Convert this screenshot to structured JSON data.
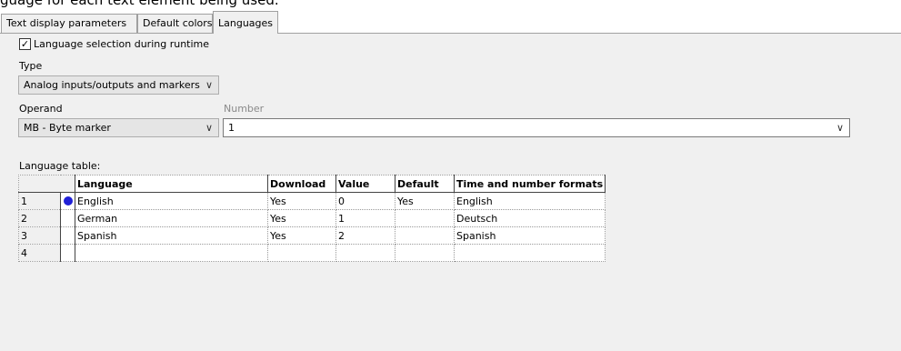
{
  "top_text": "guage for each text element being used.",
  "tabs": [
    {
      "label": "Text display parameters"
    },
    {
      "label": "Default colors"
    },
    {
      "label": "Languages",
      "active": true
    }
  ],
  "runtime_checkbox": {
    "label": "Language selection during runtime",
    "checked": true
  },
  "type": {
    "label": "Type",
    "value": "Analog inputs/outputs and markers"
  },
  "operand": {
    "label": "Operand",
    "value": "MB - Byte marker"
  },
  "number": {
    "label": "Number",
    "value": "1"
  },
  "language_table": {
    "title": "Language table:",
    "columns": [
      "Language",
      "Download",
      "Value",
      "Default",
      "Time and number formats"
    ],
    "rows": [
      {
        "num": "1",
        "indicator": true,
        "cells": [
          "English",
          "Yes",
          "0",
          "Yes",
          "English"
        ]
      },
      {
        "num": "2",
        "indicator": false,
        "cells": [
          "German",
          "Yes",
          "1",
          "",
          "Deutsch"
        ]
      },
      {
        "num": "3",
        "indicator": false,
        "cells": [
          "Spanish",
          "Yes",
          "2",
          "",
          "Spanish"
        ]
      },
      {
        "num": "4",
        "indicator": false,
        "cells": [
          "",
          "",
          "",
          "",
          ""
        ]
      }
    ]
  },
  "colors": {
    "indicator_dot": "#1f1fd6",
    "panel_bg": "#f0f0f0"
  }
}
